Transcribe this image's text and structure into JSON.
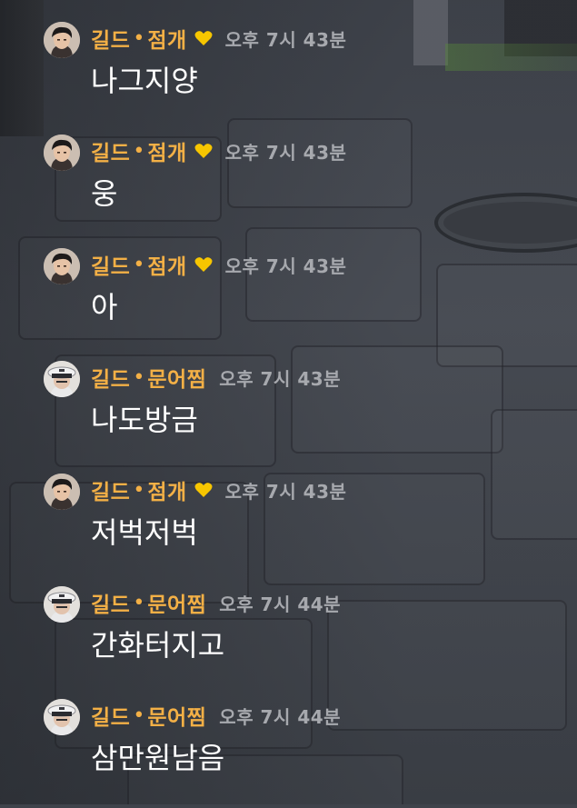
{
  "colors": {
    "name": "#f3b046",
    "time": "#a7a9ae",
    "text": "#ffffff",
    "heart": "#f7c600"
  },
  "messages": [
    {
      "guild": "길드",
      "name": "점개",
      "heart": true,
      "time": "오후 7시 43분",
      "text": "나그지양",
      "avatar": "dark-hair-avatar"
    },
    {
      "guild": "길드",
      "name": "점개",
      "heart": true,
      "time": "오후 7시 43분",
      "text": "웅",
      "avatar": "dark-hair-avatar"
    },
    {
      "guild": "길드",
      "name": "점개",
      "heart": true,
      "time": "오후 7시 43분",
      "text": "아",
      "avatar": "dark-hair-avatar"
    },
    {
      "guild": "길드",
      "name": "문어찜",
      "heart": false,
      "time": "오후 7시 43분",
      "text": "나도방금",
      "avatar": "captain-hat-avatar"
    },
    {
      "guild": "길드",
      "name": "점개",
      "heart": true,
      "time": "오후 7시 43분",
      "text": "저벅저벅",
      "avatar": "dark-hair-avatar"
    },
    {
      "guild": "길드",
      "name": "문어찜",
      "heart": false,
      "time": "오후 7시 44분",
      "text": "간화터지고",
      "avatar": "captain-hat-avatar"
    },
    {
      "guild": "길드",
      "name": "문어찜",
      "heart": false,
      "time": "오후 7시 44분",
      "text": "삼만원남음",
      "avatar": "captain-hat-avatar"
    }
  ]
}
